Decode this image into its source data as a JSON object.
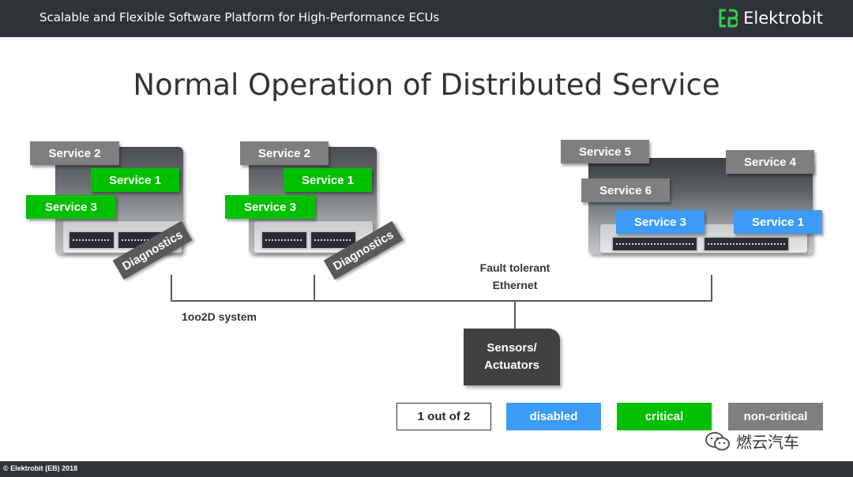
{
  "header": {
    "title": "Scalable and Flexible Software Platform for High-Performance ECUs",
    "brand": "Elektrobit"
  },
  "slide_title": "Normal Operation of Distributed Service",
  "ecu_left": {
    "services": [
      "Service 2",
      "Service 1",
      "Service 3"
    ],
    "diagnostics": "Diagnostics"
  },
  "ecu_middle": {
    "services": [
      "Service 2",
      "Service 1",
      "Service 3"
    ],
    "diagnostics": "Diagnostics"
  },
  "ecu_right": {
    "services": [
      "Service 5",
      "Service 4",
      "Service 6",
      "Service 3",
      "Service 1"
    ]
  },
  "network": {
    "ethernet_label": "Fault tolerant\nEthernet",
    "system_label": "1oo2D system"
  },
  "sensors": {
    "line1": "Sensors/",
    "line2": "Actuators"
  },
  "legend": {
    "one_of_two": "1 out of 2",
    "disabled": "disabled",
    "critical": "critical",
    "non_critical": "non-critical"
  },
  "colors": {
    "critical": "#00c000",
    "disabled": "#3a9cf7",
    "non_critical": "#7f7f7f",
    "header_bg": "#2f3338"
  },
  "watermark": "燃云汽车",
  "footer": {
    "copyright": "© Elektrobit (EB) 2018"
  }
}
